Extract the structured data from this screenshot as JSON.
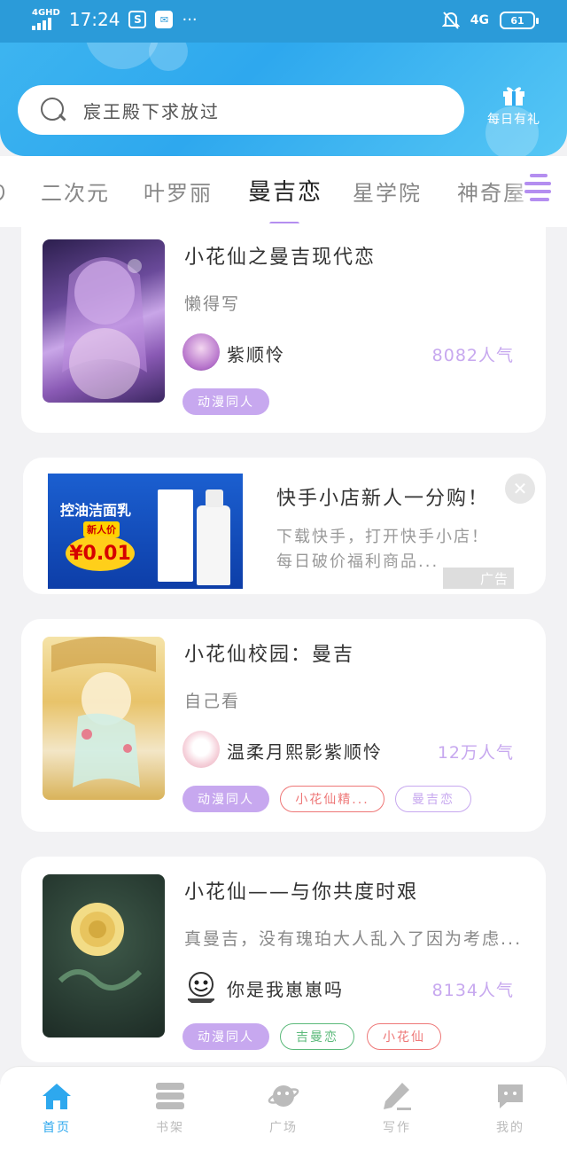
{
  "status_bar": {
    "network": "4GHD",
    "time": "17:24",
    "dots": "···",
    "mobile": "4G",
    "battery": "61"
  },
  "header": {
    "search_placeholder": "宸王殿下求放过",
    "gift_label": "每日有礼",
    "accent_color": "#2ea8ee"
  },
  "tabs": {
    "items": [
      "り",
      "二次元",
      "叶罗丽",
      "曼吉恋",
      "星学院",
      "神奇屋"
    ],
    "active_index": 3,
    "active_color": "#b48ef0"
  },
  "cards": [
    {
      "title": "小花仙之曼吉现代恋",
      "desc": "懒得写",
      "author": "紫顺怜",
      "popularity": "8082人气",
      "tags": [
        "动漫同人"
      ]
    },
    {
      "title": "小花仙校园：曼吉",
      "desc": "自己看",
      "author": "温柔月熙影紫顺怜",
      "popularity": "12万人气",
      "tags": [
        "动漫同人",
        "小花仙精...",
        "曼吉恋"
      ]
    },
    {
      "title": "小花仙——与你共度时艰",
      "desc": "真曼吉，没有瑰珀大人乱入了因为考虑...",
      "author": "你是我崽崽吗",
      "popularity": "8134人气",
      "tags": [
        "动漫同人",
        "吉曼恋",
        "小花仙"
      ]
    }
  ],
  "ad": {
    "title": "快手小店新人一分购！",
    "desc": "下载快手，打开快手小店！每日破价福利商品...",
    "badge": "广告",
    "image_headline": "控油洁面乳",
    "image_badge": "新人价",
    "image_price": "¥0.01"
  },
  "bottom_nav": {
    "items": [
      "首页",
      "书架",
      "广场",
      "写作",
      "我的"
    ],
    "active_index": 0
  }
}
